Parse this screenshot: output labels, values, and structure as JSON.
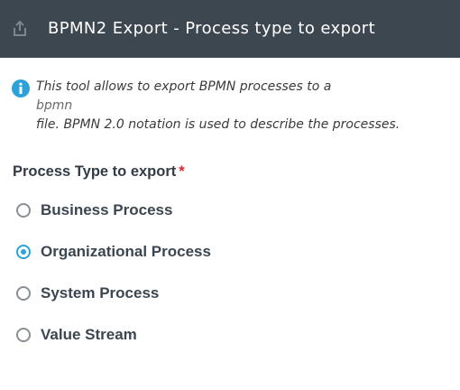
{
  "dialog": {
    "title": "BPMN2 Export - Process type to export",
    "header_icon": "export-share-icon",
    "colors": {
      "header_bg": "#3d4750",
      "accent": "#2ba3d9",
      "required": "#d9262b"
    }
  },
  "info": {
    "icon": "info-icon",
    "line1": "This tool allows to export BPMN processes to a",
    "extension": "bpmn",
    "line2": "file. BPMN 2.0 notation is used to describe the processes."
  },
  "process_type": {
    "label": "Process Type to export",
    "required_marker": "*",
    "selected": "Organizational Process",
    "options": [
      {
        "label": "Business Process",
        "checked": false
      },
      {
        "label": "Organizational Process",
        "checked": true
      },
      {
        "label": "System Process",
        "checked": false
      },
      {
        "label": "Value Stream",
        "checked": false
      }
    ]
  }
}
